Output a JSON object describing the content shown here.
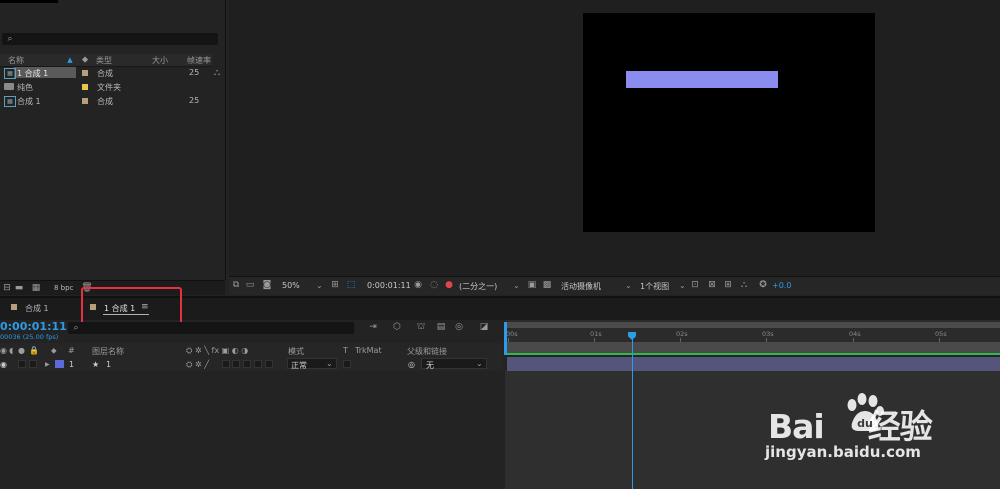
{
  "project": {
    "columns": {
      "name": "名称",
      "type": "类型",
      "size": "大小",
      "fps": "帧速率"
    },
    "items": [
      {
        "name": "1 合成 1",
        "type": "合成",
        "size": "",
        "fps": "25",
        "swatch": "#b69f7c",
        "selected": true
      },
      {
        "name": "纯色",
        "type": "文件夹",
        "size": "",
        "fps": "",
        "swatch": "#e5c54a",
        "selected": false
      },
      {
        "name": "合成 1",
        "type": "合成",
        "size": "",
        "fps": "25",
        "swatch": "#b69f7c",
        "selected": false
      }
    ],
    "bpc": "8 bpc"
  },
  "viewer_toolbar": {
    "zoom": "50%",
    "timecode": "0:00:01:11",
    "resolution": "(二分之一)",
    "camera": "活动摄像机",
    "views": "1个视图",
    "exposure": "+0.0"
  },
  "timeline": {
    "tabs": [
      {
        "label": "合成 1"
      },
      {
        "label": "1 合成 1"
      }
    ],
    "timecode": "0:00:01:11",
    "frame_info": "00036 (25.00 fps)",
    "headers": {
      "num": "#",
      "layer_name": "图层名称",
      "mode": "模式",
      "t": "T",
      "trkmat": "TrkMat",
      "parent": "父级和链接"
    },
    "layer": {
      "index": "1",
      "name": "1",
      "mode": "正常",
      "parent": "无"
    },
    "ruler": [
      "00s",
      "01s",
      "02s",
      "03s",
      "04s",
      "05s"
    ]
  },
  "watermark": {
    "logo_left": "Bai",
    "logo_right": "经验",
    "url": "jingyan.baidu.com"
  },
  "colors": {
    "accent_blue": "#2d9ce8",
    "layer_bar": "#55557c",
    "comp_shape": "#8a8cf0",
    "highlight": "#e4333e"
  }
}
